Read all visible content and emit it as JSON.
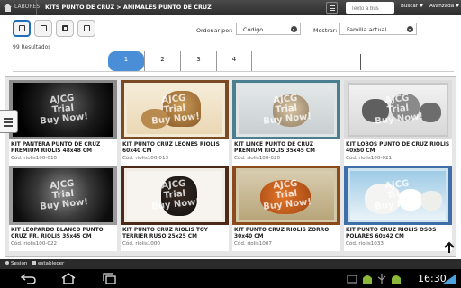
{
  "topbar": {
    "root_label": "LABORES",
    "breadcrumb": "KITS PUNTO DE CRUZ > ANIMALES PUNTO DE CRUZ",
    "search_placeholder": "Texto a bus",
    "search_button": "Buscar",
    "advanced_button": "Avanzada"
  },
  "toolbar": {
    "results": "99 Resultados",
    "sort_label": "Ordenar por:",
    "sort_value": "Código",
    "show_label": "Mostrar:",
    "show_value": "Familia actual"
  },
  "pagination": [
    "1",
    "2",
    "3",
    "4"
  ],
  "watermark": [
    "AJCG",
    "Trial",
    "Buy Now!"
  ],
  "products": [
    {
      "title": "KIT PANTERA PUNTO DE CRUZ PREMIUM RIOLIS 48x48 CM",
      "code": "Cód. riolis100-010"
    },
    {
      "title": "KIT PUNTO CRUZ LEONES RIOLIS 60x40 CM",
      "code": "Cód. riolis100-013"
    },
    {
      "title": "KIT LINCE PUNTO DE CRUZ PREMIUM RIOLIS 35x45 CM",
      "code": "Cód. riolis100-020"
    },
    {
      "title": "KIT LOBOS PUNTO DE CRUZ RIOLIS 40x60 CM",
      "code": "Cód. riolis100-021"
    },
    {
      "title": "KIT LEOPARDO BLANCO PUNTO CRUZ PR. RIOLIS 35x45 CM",
      "code": "Cód. riolis100-022"
    },
    {
      "title": "KIT PUNTO CRUZ RIOLIS TOY TERRIER RUSO 25x25 CM",
      "code": "Cód. riolis1000"
    },
    {
      "title": "KIT PUNTO CRUZ RIOLIS ZORRO 30x40 CM",
      "code": "Cód. riolis1007"
    },
    {
      "title": "KIT PUNTO CRUZ RIOLIS OSOS POLARES 60x42 CM",
      "code": "Cód. riolis1033"
    }
  ],
  "appbar": {
    "session": "Sesión",
    "establish": "establecer"
  },
  "system": {
    "clock": "16:30"
  }
}
